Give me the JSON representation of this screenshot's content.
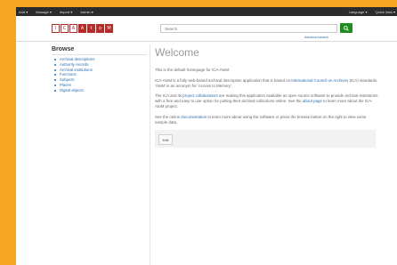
{
  "topbar": {
    "left": [
      "Add ▾",
      "Manage ▾",
      "Import ▾",
      "Admin ▾"
    ],
    "right": [
      "Language ▾",
      "Quick links ▾"
    ]
  },
  "header": {
    "logo": [
      "I",
      "C",
      "A",
      "A",
      "t",
      "o",
      "M"
    ],
    "search_placeholder": "Search",
    "advanced_link": "Advanced search"
  },
  "sidebar": {
    "title": "Browse",
    "items": [
      "Archival descriptions",
      "Authority records",
      "Archival institutions",
      "Functions",
      "Subjects",
      "Places",
      "Digital objects"
    ]
  },
  "main": {
    "title": "Welcome",
    "p1": "This is the default homepage for ICA-AtoM.",
    "p2a": "ICA-AtoM is a fully web-based archival description application that is based on ",
    "p2link": "International Council on Archives",
    "p2b": " (ICA) standards. 'AtoM' is an acronym for 'Access to Memory'.",
    "p3a": "The ICA and its ",
    "p3link1": "project collaborators",
    "p3b": " are making this application available as open source software to provide archival institutions with a free and easy to use option for putting their archival collections online. See the ",
    "p3link2": "about page",
    "p3c": " to learn more about the ICA-AtoM project.",
    "p4a": "See the online ",
    "p4link": "documentation",
    "p4b": " to learn more about using the software or press the browse button on the right to view some sample data.",
    "edit_label": "Edit"
  }
}
